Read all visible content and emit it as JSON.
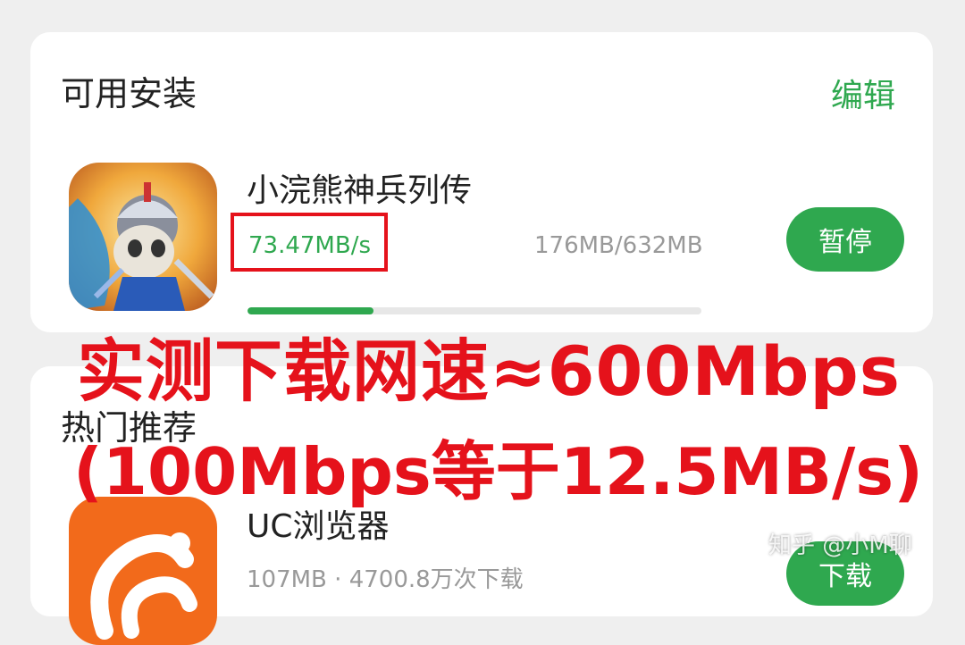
{
  "installs": {
    "title": "可用安装",
    "edit_label": "编辑",
    "app": {
      "name": "小浣熊神兵列传",
      "speed": "73.47MB/s",
      "size_progress": "176MB/632MB",
      "progress_fraction": 0.2785,
      "action_label": "暂停",
      "icon": "raccoon-game-icon"
    }
  },
  "hot": {
    "title": "热门推荐",
    "app": {
      "name": "UC浏览器",
      "meta": "107MB · 4700.8万次下载",
      "action_label": "下载",
      "icon": "uc-browser-icon"
    }
  },
  "overlay": {
    "line1": "实测下载网速≈600Mbps",
    "line2": "(100Mbps等于12.5MB/s)"
  },
  "watermark": "知乎 @小M聊",
  "colors": {
    "accent": "#2fa84f",
    "annotation_red": "#e5121b",
    "background": "#efefef"
  }
}
